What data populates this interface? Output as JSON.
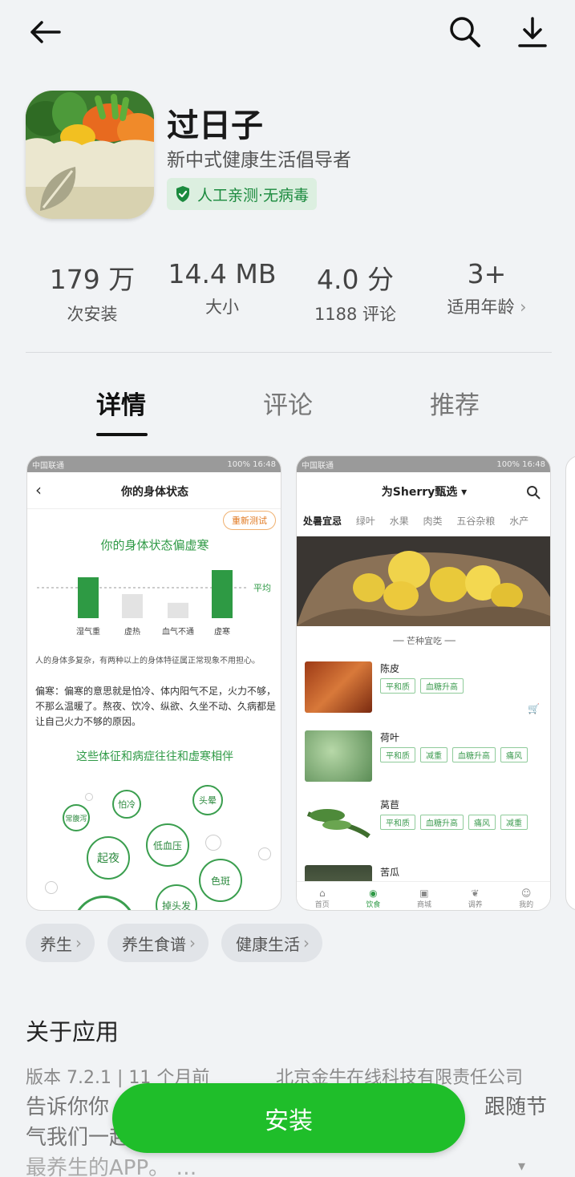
{
  "app": {
    "name": "过日子",
    "subtitle": "新中式健康生活倡导者",
    "badge": "人工亲测·无病毒"
  },
  "stats": [
    {
      "value": "179 万",
      "label": "次安装"
    },
    {
      "value": "14.4 MB",
      "label": "大小"
    },
    {
      "value": "4.0 分",
      "label": "1188 评论"
    },
    {
      "value": "3+",
      "label": "适用年龄"
    }
  ],
  "tabs": [
    "详情",
    "评论",
    "推荐"
  ],
  "screenshot1": {
    "status_left": "中国联通",
    "status_right": "100% 16:48",
    "title": "你的身体状态",
    "retest": "重新测试",
    "heading": "你的身体状态偏虚寒",
    "avg_label": "平均",
    "bars": [
      {
        "label": "湿气重",
        "value": 0.85
      },
      {
        "label": "虚热",
        "value": 0.5
      },
      {
        "label": "血气不通",
        "value": 0.32
      },
      {
        "label": "虚寒",
        "value": 1.0
      }
    ],
    "note": "人的身体多复杂，有两种以上的身体特征属正常现象不用担心。",
    "para": "偏寒：偏寒的意思就是怕冷、体内阳气不足，火力不够，不那么温暖了。熬夜、饮冷、纵欲、久坐不动、久病都是让自己火力不够的原因。",
    "subheading": "这些体征和病症往往和虚寒相伴",
    "bubbles": [
      "常腹泻",
      "怕冷",
      "头晕",
      "起夜",
      "低血压",
      "色斑",
      "掉头发"
    ]
  },
  "screenshot2": {
    "status_left": "中国联通",
    "status_right": "100% 16:48",
    "title": "为Sherry甄选",
    "categories": [
      "处暑宜忌",
      "绿叶",
      "水果",
      "肉类",
      "五谷杂粮",
      "水产"
    ],
    "section": "芒种宜吃",
    "foods": [
      {
        "name": "陈皮",
        "tags": [
          "平和质",
          "血糖升高"
        ]
      },
      {
        "name": "荷叶",
        "tags": [
          "平和质",
          "减重",
          "血糖升高",
          "痛风"
        ]
      },
      {
        "name": "莴苣",
        "tags": [
          "平和质",
          "血糖升高",
          "痛风",
          "减重"
        ]
      },
      {
        "name": "苦瓜",
        "tags": []
      }
    ],
    "nav": [
      "首页",
      "饮食",
      "商城",
      "调养",
      "我的"
    ]
  },
  "tags": [
    "养生",
    "养生食谱",
    "健康生活"
  ],
  "about": {
    "heading": "关于应用",
    "version": "版本 7.2.1 | 11 个月前",
    "developer": "北京金牛在线科技有限责任公司",
    "desc_line1": "告诉你你",
    "desc_line1_right": "跟随节",
    "desc_line2": "气我们一起",
    "desc_line3": "最养生的APP。 …"
  },
  "install_label": "安装"
}
